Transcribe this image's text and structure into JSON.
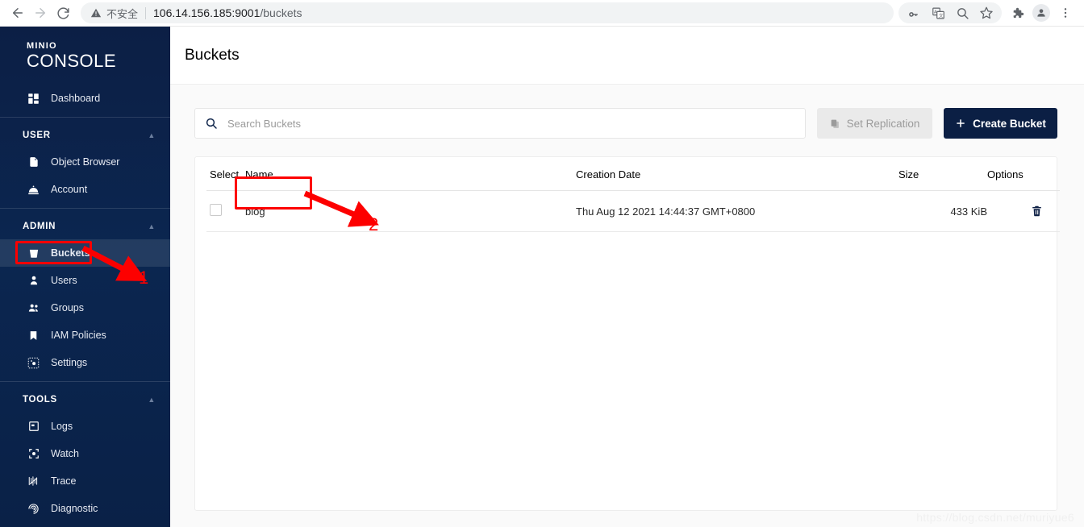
{
  "browser": {
    "back_icon": "arrow-left-icon",
    "forward_icon": "arrow-right-icon",
    "reload_icon": "reload-icon",
    "security_label": "不安全",
    "url_host": "106.14.156.185:9001",
    "url_path": "/buckets",
    "actions": [
      {
        "name": "password-key-icon",
        "glyph": "key"
      },
      {
        "name": "translate-icon",
        "glyph": "translate"
      },
      {
        "name": "zoom-out-icon",
        "glyph": "search"
      },
      {
        "name": "bookmark-star-icon",
        "glyph": "star"
      }
    ],
    "extensions_icon": "puzzle-piece-icon",
    "profile_icon": "user-avatar-icon",
    "menu_icon": "three-dot-menu-icon"
  },
  "sidebar": {
    "logo_top": "MINIO",
    "logo_main": "CONSOLE",
    "dashboard": {
      "label": "Dashboard",
      "icon": "dashboard-grid-icon"
    },
    "sections": [
      {
        "title": "USER",
        "items": [
          {
            "label": "Object Browser",
            "icon": "document-icon"
          },
          {
            "label": "Account",
            "icon": "account-bell-icon"
          }
        ]
      },
      {
        "title": "ADMIN",
        "items": [
          {
            "label": "Buckets",
            "icon": "bucket-icon",
            "selected": true
          },
          {
            "label": "Users",
            "icon": "user-icon"
          },
          {
            "label": "Groups",
            "icon": "groups-icon"
          },
          {
            "label": "IAM Policies",
            "icon": "bookmark-icon"
          },
          {
            "label": "Settings",
            "icon": "settings-gear-icon"
          }
        ]
      },
      {
        "title": "TOOLS",
        "items": [
          {
            "label": "Logs",
            "icon": "logs-window-icon"
          },
          {
            "label": "Watch",
            "icon": "watch-target-icon"
          },
          {
            "label": "Trace",
            "icon": "trace-waves-icon"
          },
          {
            "label": "Diagnostic",
            "icon": "diagnostic-spiral-icon"
          }
        ]
      }
    ]
  },
  "page": {
    "title": "Buckets"
  },
  "toolbar": {
    "search_placeholder": "Search Buckets",
    "search_value": "",
    "search_icon": "search-icon",
    "set_replication_label": "Set Replication",
    "set_replication_icon": "copy-icon",
    "create_bucket_label": "Create Bucket",
    "create_bucket_icon": "plus-icon"
  },
  "table": {
    "columns": [
      "Select",
      "Name",
      "Creation Date",
      "Size",
      "Options"
    ],
    "rows": [
      {
        "selected": false,
        "name": "blog",
        "creation_date": "Thu Aug 12 2021 14:44:37 GMT+0800",
        "size": "433 KiB",
        "delete_icon": "trash-icon"
      }
    ]
  },
  "annotations": {
    "marker_one": "1",
    "marker_two": "2",
    "highlight_color": "#fd0000"
  },
  "watermark": "https://blog.csdn.net/muriyue6"
}
